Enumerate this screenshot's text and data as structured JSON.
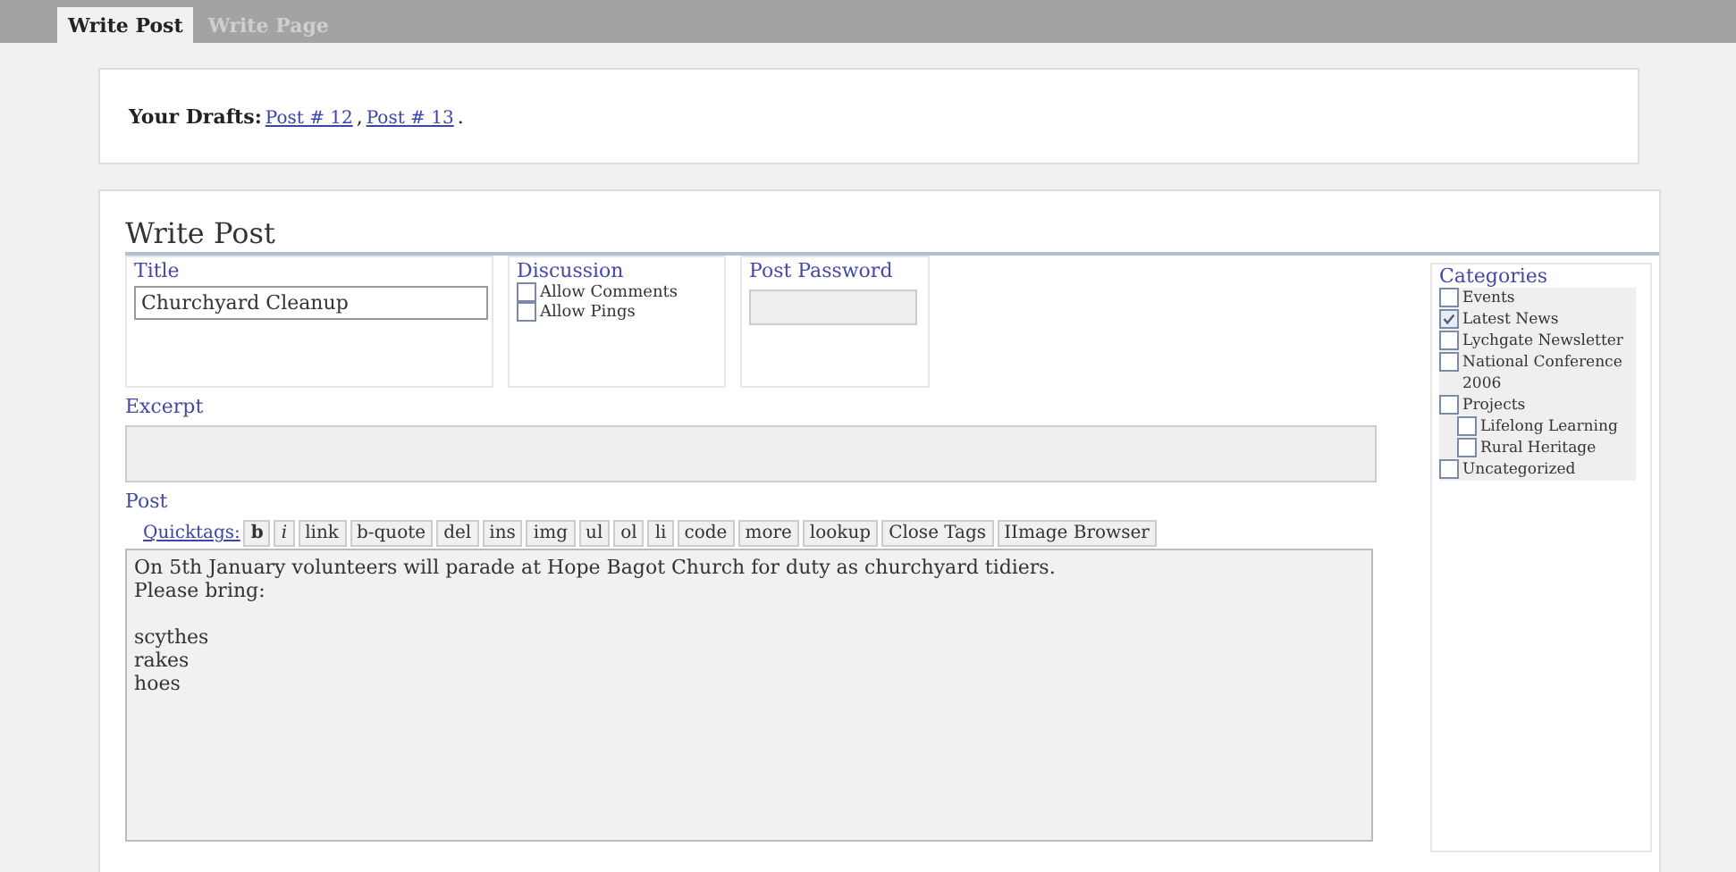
{
  "tabs": [
    {
      "label": "Write Post",
      "selected": true
    },
    {
      "label": "Write Page",
      "selected": false
    }
  ],
  "drafts": {
    "label": "Your Drafts:",
    "links": [
      "Post # 12",
      "Post # 13"
    ],
    "separator": ",",
    "end": "."
  },
  "heading": "Write Post",
  "title_box": {
    "label": "Title",
    "value": "Churchyard Cleanup"
  },
  "discussion": {
    "label": "Discussion",
    "options": [
      {
        "label": "Allow Comments",
        "checked": false
      },
      {
        "label": "Allow Pings",
        "checked": false
      }
    ]
  },
  "password": {
    "label": "Post Password"
  },
  "excerpt": {
    "label": "Excerpt"
  },
  "post": {
    "label": "Post",
    "quicktags_label": "Quicktags:",
    "buttons": [
      "b",
      "i",
      "link",
      "b-quote",
      "del",
      "ins",
      "img",
      "ul",
      "ol",
      "li",
      "code",
      "more",
      "lookup",
      "Close Tags",
      "IImage Browser"
    ],
    "content": "On 5th January volunteers will parade at Hope Bagot Church for duty as churchyard tidiers.\nPlease bring:\n\nscythes\nrakes\nhoes"
  },
  "categories": {
    "label": "Categories",
    "items": [
      {
        "label": "Events",
        "checked": false
      },
      {
        "label": "Latest News",
        "checked": true
      },
      {
        "label": "Lychgate Newsletter",
        "checked": false
      },
      {
        "label": "National Conference 2006",
        "checked": false
      },
      {
        "label": "Projects",
        "checked": false,
        "children": [
          {
            "label": "Lifelong Learning",
            "checked": false
          },
          {
            "label": "Rural Heritage",
            "checked": false
          }
        ]
      },
      {
        "label": "Uncategorized",
        "checked": false
      }
    ]
  }
}
